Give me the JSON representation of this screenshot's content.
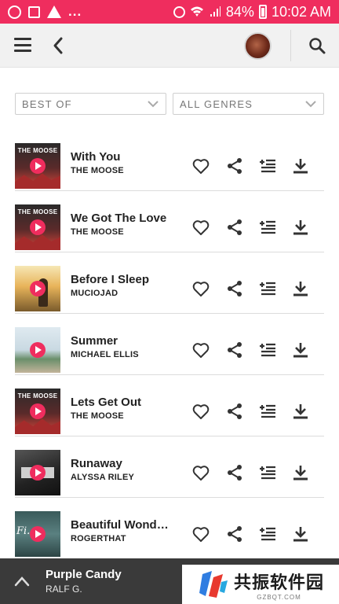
{
  "status_bar": {
    "battery": "84%",
    "time": "10:02 AM",
    "overflow": "..."
  },
  "filters": {
    "left": "BEST OF",
    "right": "ALL GENRES"
  },
  "tracks": [
    {
      "title": "With You",
      "artist": "THE MOOSE",
      "cover_text": "THE MOOSE"
    },
    {
      "title": "We Got The Love",
      "artist": "THE MOOSE",
      "cover_text": "THE MOOSE"
    },
    {
      "title": "Before I Sleep",
      "artist": "MUCIOJAD",
      "cover_text": ""
    },
    {
      "title": "Summer",
      "artist": "MICHAEL ELLIS",
      "cover_text": ""
    },
    {
      "title": "Lets Get Out",
      "artist": "THE MOOSE",
      "cover_text": "THE MOOSE"
    },
    {
      "title": "Runaway",
      "artist": "ALYSSA RILEY",
      "cover_text": ""
    },
    {
      "title": "Beautiful Wonde...",
      "artist": "ROGERTHAT",
      "cover_text": ""
    }
  ],
  "now_playing": {
    "title": "Purple Candy",
    "artist": "RALF G."
  },
  "watermark": {
    "name": "共振软件园",
    "url": "GZBQT.COM"
  },
  "colors": {
    "accent": "#ef2d5e",
    "player_bg": "#3a3a3a"
  }
}
